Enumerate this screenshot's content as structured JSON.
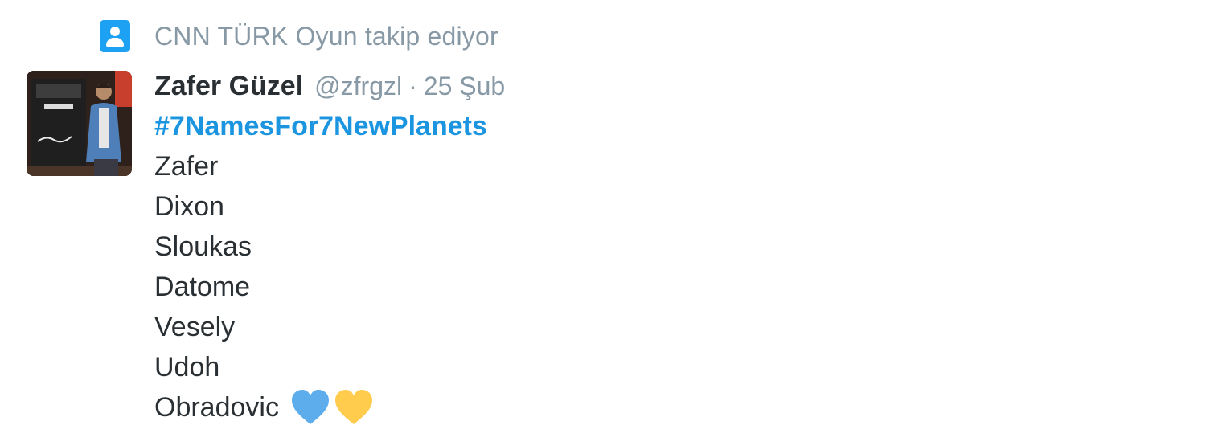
{
  "context": {
    "text": "CNN TÜRK Oyun takip ediyor",
    "icon": "follow-user-icon",
    "icon_color": "#1da1f2"
  },
  "tweet": {
    "fullname": "Zafer Güzel",
    "username": "@zfrgzl",
    "separator": "·",
    "time": "25 Şub",
    "hashtag": "#7NamesFor7NewPlanets",
    "lines": [
      "Zafer",
      "Dixon",
      "Sloukas",
      "Datome",
      "Vesely",
      "Udoh",
      "Obradovic"
    ],
    "emojis": [
      {
        "name": "blue-heart-icon",
        "color": "#5dadec"
      },
      {
        "name": "yellow-heart-icon",
        "color": "#ffcc4d"
      }
    ]
  },
  "colors": {
    "text": "#292f33",
    "muted": "#8899a6",
    "link": "#1b95e0"
  }
}
